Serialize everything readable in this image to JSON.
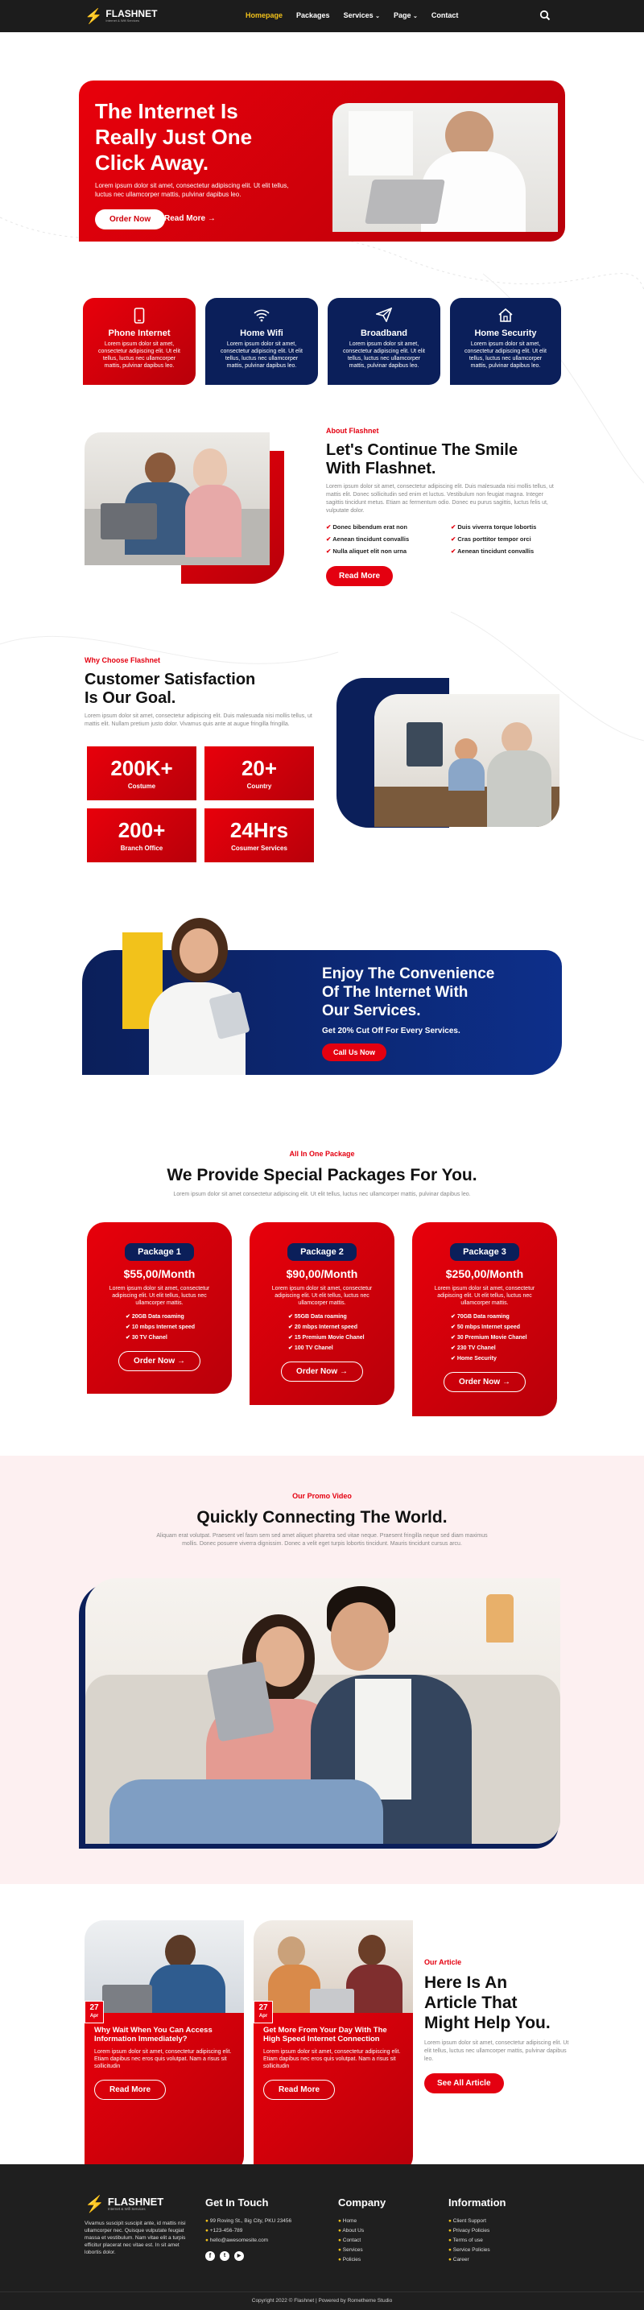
{
  "nav": {
    "brand": "FLASHNET",
    "brand_tag": "Internet & Wifi Services",
    "items": [
      "Homepage",
      "Packages",
      "Services",
      "Page",
      "Contact"
    ],
    "active": "Homepage"
  },
  "hero": {
    "title_lines": [
      "The Internet Is",
      "Really Just One",
      "Click Away."
    ],
    "text": "Lorem ipsum dolor sit amet, consectetur adipiscing elit. Ut elit tellus, luctus nec ullamcorper mattis, pulvinar dapibus leo.",
    "order_btn": "Order Now",
    "read_btn": "Read More"
  },
  "services": [
    {
      "title": "Phone Internet",
      "icon": "phone-icon",
      "text": "Lorem ipsum dolor sit amet, consectetur adipiscing elit. Ut elit tellus, luctus nec ullamcorper mattis, pulvinar dapibus leo."
    },
    {
      "title": "Home Wifi",
      "icon": "wifi-icon",
      "text": "Lorem ipsum dolor sit amet, consectetur adipiscing elit. Ut elit tellus, luctus nec ullamcorper mattis, pulvinar dapibus leo."
    },
    {
      "title": "Broadband",
      "icon": "send-icon",
      "text": "Lorem ipsum dolor sit amet, consectetur adipiscing elit. Ut elit tellus, luctus nec ullamcorper mattis, pulvinar dapibus leo."
    },
    {
      "title": "Home Security",
      "icon": "home-icon",
      "text": "Lorem ipsum dolor sit amet, consectetur adipiscing elit. Ut elit tellus, luctus nec ullamcorper mattis, pulvinar dapibus leo."
    }
  ],
  "about": {
    "kicker": "About Flashnet",
    "title_lines": [
      "Let's Continue The Smile",
      "With Flashnet."
    ],
    "text": "Lorem ipsum dolor sit amet, consectetur adipiscing elit. Duis malesuada nisi mollis tellus, ut mattis elit. Donec sollicitudin sed enim et luctus. Vestibulum non feugiat magna. Integer sagittis tincidunt metus. Etiam ac fermentum odio. Donec eu purus sagittis, luctus felis ut, vulputate dolor.",
    "list_left": [
      "Donec bibendum erat non",
      "Aenean tincidunt convallis",
      "Nulla aliquet elit non urna"
    ],
    "list_right": [
      "Duis viverra torque lobortis",
      "Cras porttitor tempor orci",
      "Aenean tincidunt convallis"
    ],
    "btn": "Read More"
  },
  "why": {
    "kicker": "Why Choose Flashnet",
    "title_lines": [
      "Customer Satisfaction",
      "Is Our Goal."
    ],
    "text": "Lorem ipsum dolor sit amet, consectetur adipiscing elit. Duis malesuada nisi mollis tellus, ut mattis elit. Nullam pretium justo dolor. Vivamus quis ante at augue fringilla fringilla.",
    "stats": [
      {
        "value": "200K+",
        "label": "Costume"
      },
      {
        "value": "20+",
        "label": "Country"
      },
      {
        "value": "200+",
        "label": "Branch Office"
      },
      {
        "value": "24Hrs",
        "label": "Cosumer Services"
      }
    ]
  },
  "cta": {
    "title_lines": [
      "Enjoy The Convenience",
      "Of The Internet With",
      "Our Services."
    ],
    "sub": "Get 20% Cut Off For Every Services.",
    "btn": "Call Us Now"
  },
  "packages": {
    "kicker": "All In One Package",
    "title": "We Provide Special Packages For You.",
    "text": "Lorem ipsum dolor sit amet consectetur adipiscing elit. Ut elit tellus, luctus nec ullamcorper mattis, pulvinar dapibus leo.",
    "items": [
      {
        "name": "Package 1",
        "price": "$55,00/Month",
        "text": "Lorem ipsum dolor sit amet, consectetur adipiscing elit. Ut elit tellus, luctus nec ullamcorper mattis.",
        "features": [
          "20GB Data roaming",
          "10 mbps Internet speed",
          "30 TV Chanel"
        ],
        "btn": "Order Now"
      },
      {
        "name": "Package 2",
        "price": "$90,00/Month",
        "text": "Lorem ipsum dolor sit amet, consectetur adipiscing elit. Ut elit tellus, luctus nec ullamcorper mattis.",
        "features": [
          "55GB Data roaming",
          "20 mbps Internet speed",
          "15 Premium Movie Chanel",
          "100 TV Chanel"
        ],
        "btn": "Order Now"
      },
      {
        "name": "Package 3",
        "price": "$250,00/Month",
        "text": "Lorem ipsum dolor sit amet, consectetur adipiscing elit. Ut elit tellus, luctus nec ullamcorper mattis.",
        "features": [
          "70GB Data roaming",
          "50 mbps Internet speed",
          "30 Premium Movie Chanel",
          "230 TV Chanel",
          "Home Security"
        ],
        "btn": "Order Now"
      }
    ]
  },
  "video": {
    "kicker": "Our Promo Video",
    "title": "Quickly Connecting The World.",
    "text": "Aliquam erat volutpat. Praesent vel fasm sem sed amet aliquet pharetra sed vitae neque. Praesent fringilla neque sed diam maximus mollis. Donec posuere viverra dignissim. Donec a velit eget turpis lobortis tincidunt. Mauris tincidunt cursus arcu."
  },
  "articles": {
    "kicker": "Our Article",
    "title_lines": [
      "Here Is An",
      "Article That",
      "Might Help You."
    ],
    "text": "Lorem ipsum dolor sit amet, consectetur adipiscing elit. Ut elit tellus, luctus nec ullamcorper mattis, pulvinar dapibus leo.",
    "btn": "See All Article",
    "items": [
      {
        "day": "27",
        "month": "Apr",
        "title": "Why Wait When You Can Access Information Immediately?",
        "text": "Lorem ipsum dolor sit amet, consectetur adipiscing elit. Etiam dapibus nec eros quis volutpat. Nam a risus sit sollicitudin",
        "btn": "Read More"
      },
      {
        "day": "27",
        "month": "Apr",
        "title": "Get More From Your Day With The High Speed Internet Connection",
        "text": "Lorem ipsum dolor sit amet, consectetur adipiscing elit. Etiam dapibus nec eros quis volutpat. Nam a risus sit sollicitudin",
        "btn": "Read More"
      }
    ]
  },
  "footer": {
    "brand": "FLASHNET",
    "brand_tag": "Internet & Wifi Services",
    "about": "Vivamus suscipit suscipit ante, id mattis nisi ullamcorper nec. Quisque vulputate feugiat massa et vestibulum. Nam vitae elit a turpis efficitur placerat nec vitae est. In sit amet lobortis dolor.",
    "touch_title": "Get In Touch",
    "touch": [
      "99 Roving St., Big City, PKU 23456",
      "+123-456-789",
      "hello@awesomesite.com"
    ],
    "company_title": "Company",
    "company": [
      "Home",
      "About Us",
      "Contact",
      "Services",
      "Policies"
    ],
    "info_title": "Information",
    "info": [
      "Client Support",
      "Privacy Policies",
      "Terms of use",
      "Service Policies",
      "Career"
    ],
    "copyright": "Copyright 2022 © Flashnet | Powered by Rometheme Studio"
  },
  "colors": {
    "red": "#e40010",
    "navy": "#0b1f5a",
    "dark": "#1f1f1f",
    "yellow": "#f2c21b"
  }
}
